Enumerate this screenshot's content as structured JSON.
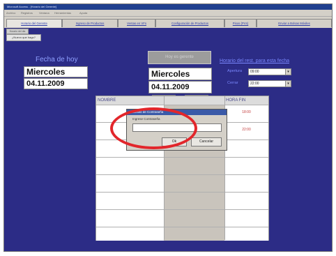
{
  "window": {
    "title": "Microsoft Access - [Horario del Gerente]"
  },
  "menu": [
    "Archivo",
    "Registros",
    "Ventana",
    "Herramientas",
    "Ayuda"
  ],
  "tabs": [
    {
      "label": "Horario del Gerente",
      "active": true
    },
    {
      "label": "Ingreso de Productos",
      "active": false
    },
    {
      "label": "Ventas en VFs",
      "active": false
    },
    {
      "label": "Configuración de Productos",
      "active": false
    },
    {
      "label": "Pisos (PVs)",
      "active": false
    },
    {
      "label": "Enviar a Bolsas Móviles",
      "active": false
    }
  ],
  "subtab": "Horario del dia",
  "sub_button": "¿Nuevo que hago?",
  "left": {
    "heading": "Fecha de hoy",
    "day": "Miercoles",
    "date": "04.11.2009"
  },
  "center": {
    "top_button": "Hoy es gerente",
    "day": "Miercoles",
    "date": "04.11.2009",
    "prev": "<<",
    "next": ">>"
  },
  "right": {
    "heading": "Horario del rest. para esta fecha",
    "open_label": "Apertura",
    "open_value": "09:00",
    "close_label": "Cerrar",
    "close_value": "22:00"
  },
  "grid": {
    "col1_header": "NOMBRE",
    "col3_header": "HORA FIN",
    "times": [
      "18:00",
      "22:00"
    ]
  },
  "dialog": {
    "title": "Cambio de Contraseña",
    "prompt": "Ingrese Contraseña",
    "ok": "Ok",
    "cancel": "Cancelar"
  },
  "colors": {
    "background": "#2c2c86",
    "highlight": "#e2262b"
  }
}
